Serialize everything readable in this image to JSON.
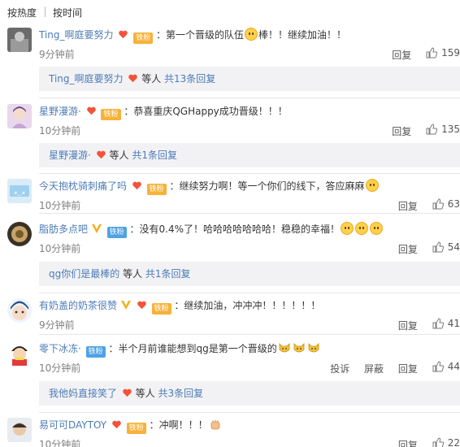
{
  "sort": {
    "hot": "按热度",
    "time": "按时间"
  },
  "comments": [
    {
      "user": "Ting_啊庭要努力",
      "badge": "铁粉",
      "text": "：第一个晋级的队伍",
      "text2": "棒！！继续加油！！",
      "time": "9分钟前",
      "reply": "回复",
      "likes": "159",
      "sub": {
        "user": "Ting_啊庭要努力",
        "mid": "等人",
        "more": "共13条回复"
      }
    },
    {
      "user": "星野漫游·",
      "badge": "铁粉",
      "text": "：恭喜重庆QGHappy成功晋级！！！",
      "time": "10分钟前",
      "reply": "回复",
      "likes": "135",
      "sub": {
        "user": "星野漫游·",
        "mid": "等人",
        "more": "共1条回复"
      }
    },
    {
      "user": "今天抱枕骑刺痛了吗",
      "badge": "铁粉",
      "text": "：继续努力啊！等一个你们的线下，答应麻麻",
      "time": "10分钟前",
      "reply": "回复",
      "likes": "63"
    },
    {
      "user": "脂肪多点吧",
      "badge": "铁粉",
      "text": "：没有0.4%了！哈哈哈哈哈哈哈！稳稳的幸福！",
      "time": "10分钟前",
      "reply": "回复",
      "likes": "54",
      "sub": {
        "user": "qg你们是最棒的",
        "mid": "等人",
        "more": "共1条回复"
      }
    },
    {
      "user": "有奶盖的奶茶很赞",
      "badge": "铁粉",
      "text": "：继续加油，冲冲冲！！！！！！",
      "time": "9分钟前",
      "reply": "回复",
      "likes": "41"
    },
    {
      "user": "零下冰冻·",
      "badge": "铁粉",
      "text": "：半个月前谁能想到qg是第一个晋级的",
      "time": "10分钟前",
      "report": "投诉",
      "block": "屏蔽",
      "reply": "回复",
      "likes": "44",
      "sub": {
        "user": "我他妈直接笑了",
        "mid": "等人",
        "more": "共3条回复"
      }
    },
    {
      "user": "易可可DAYTOY",
      "badge": "铁粉",
      "text": "：冲啊！！！",
      "time": "10分钟前",
      "reply": "回复",
      "likes": "22"
    }
  ],
  "colors": {
    "link": "#4d7bb6",
    "badge_iron": "#f7b23b",
    "badge_blue": "#4ea2e4",
    "reply_bg": "#f2f2f5"
  }
}
